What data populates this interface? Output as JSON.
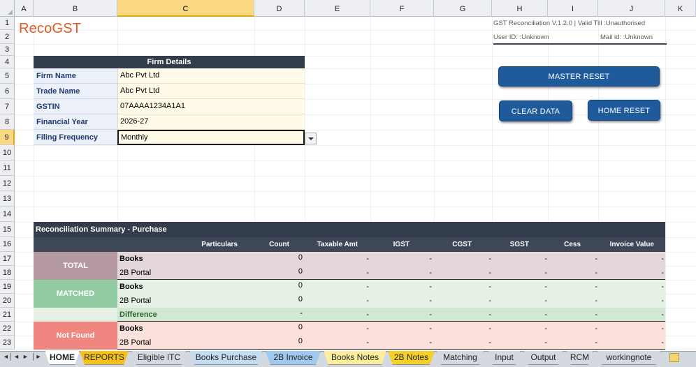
{
  "columns": [
    "A",
    "B",
    "C",
    "D",
    "E",
    "F",
    "G",
    "H",
    "I",
    "J",
    "K"
  ],
  "rows": [
    "1",
    "2",
    "3",
    "4",
    "5",
    "6",
    "7",
    "8",
    "9",
    "10",
    "11",
    "12",
    "13",
    "14",
    "15",
    "16",
    "17",
    "18",
    "19",
    "20",
    "21",
    "22",
    "23"
  ],
  "selected": {
    "column": "C",
    "row": "9"
  },
  "app": {
    "title": "RecoGST"
  },
  "header_info": {
    "version": "GST Reconciliation  V.1.2.0  |  Valid Till :Unauthorised",
    "user_id": "User ID: :Unknown",
    "mail_id": "Mail id: :Unknown"
  },
  "firm_details": {
    "header": "Firm Details",
    "fields": [
      {
        "label": "Firm Name",
        "value": "Abc Pvt Ltd"
      },
      {
        "label": "Trade Name",
        "value": "Abc Pvt Ltd"
      },
      {
        "label": "GSTIN",
        "value": "07AAAA1234A1A1"
      },
      {
        "label": "Financial Year",
        "value": "2026-27"
      },
      {
        "label": "Filing Frequency",
        "value": "Monthly"
      }
    ]
  },
  "buttons": {
    "master_reset": "MASTER RESET",
    "clear_data": "CLEAR  DATA",
    "home_reset": "HOME RESET"
  },
  "summary": {
    "title": "Reconciliation Summary - Purchase",
    "columns": [
      "Particulars",
      "Count",
      "Taxable Amt",
      "IGST",
      "CGST",
      "SGST",
      "Cess",
      "Invoice Value"
    ],
    "groups": [
      {
        "label": "TOTAL",
        "color": "#b49aa0",
        "band": "#e4d7da",
        "rows": [
          {
            "label": "Books",
            "bold": true,
            "count": "0",
            "values": [
              "-",
              "-",
              "-",
              "-",
              "-",
              "-"
            ]
          },
          {
            "label": "2B Portal",
            "bold": false,
            "count": "0",
            "values": [
              "-",
              "-",
              "-",
              "-",
              "-",
              "-"
            ]
          }
        ]
      },
      {
        "label": "MATCHED",
        "color": "#93cca3",
        "band": "#e6f1e6",
        "rows": [
          {
            "label": "Books",
            "bold": true,
            "count": "0",
            "values": [
              "-",
              "-",
              "-",
              "-",
              "-",
              "-"
            ]
          },
          {
            "label": "2B Portal",
            "bold": false,
            "count": "0",
            "values": [
              "-",
              "-",
              "-",
              "-",
              "-",
              "-"
            ]
          },
          {
            "label": "Difference",
            "bold": true,
            "green": true,
            "count": "-",
            "values": [
              "-",
              "-",
              "-",
              "-",
              "-",
              "-"
            ]
          }
        ]
      },
      {
        "label": "Not Found",
        "color": "#f08680",
        "band": "#fbe0dc",
        "rows": [
          {
            "label": "Books",
            "bold": true,
            "count": "0",
            "values": [
              "-",
              "-",
              "-",
              "-",
              "-",
              "-"
            ]
          },
          {
            "label": "2B Portal",
            "bold": false,
            "count": "0",
            "values": [
              "-",
              "-",
              "-",
              "-",
              "-",
              "-"
            ]
          }
        ]
      }
    ]
  },
  "sheet_tabs": [
    {
      "label": "HOME",
      "color": "#ffffff",
      "active": true
    },
    {
      "label": "REPORTS",
      "color": "#f6c21a"
    },
    {
      "label": "Eligible ITC",
      "color": "#d4d8df"
    },
    {
      "label": "Books Purchase",
      "color": "#c4dcf1"
    },
    {
      "label": "2B Invoice",
      "color": "#9fc9ee"
    },
    {
      "label": "Books Notes",
      "color": "#fcee9c"
    },
    {
      "label": "2B Notes",
      "color": "#f6d02a"
    },
    {
      "label": "Matching",
      "color": "#d4d8df"
    },
    {
      "label": "Input",
      "color": "#d4d8df"
    },
    {
      "label": "Output",
      "color": "#d4d8df"
    },
    {
      "label": "RCM",
      "color": "#d4d8df"
    },
    {
      "label": "workingnote",
      "color": "#d4d8df"
    }
  ],
  "nav_icons": [
    "first-sheet-icon",
    "prev-sheet-icon",
    "next-sheet-icon",
    "last-sheet-icon"
  ]
}
